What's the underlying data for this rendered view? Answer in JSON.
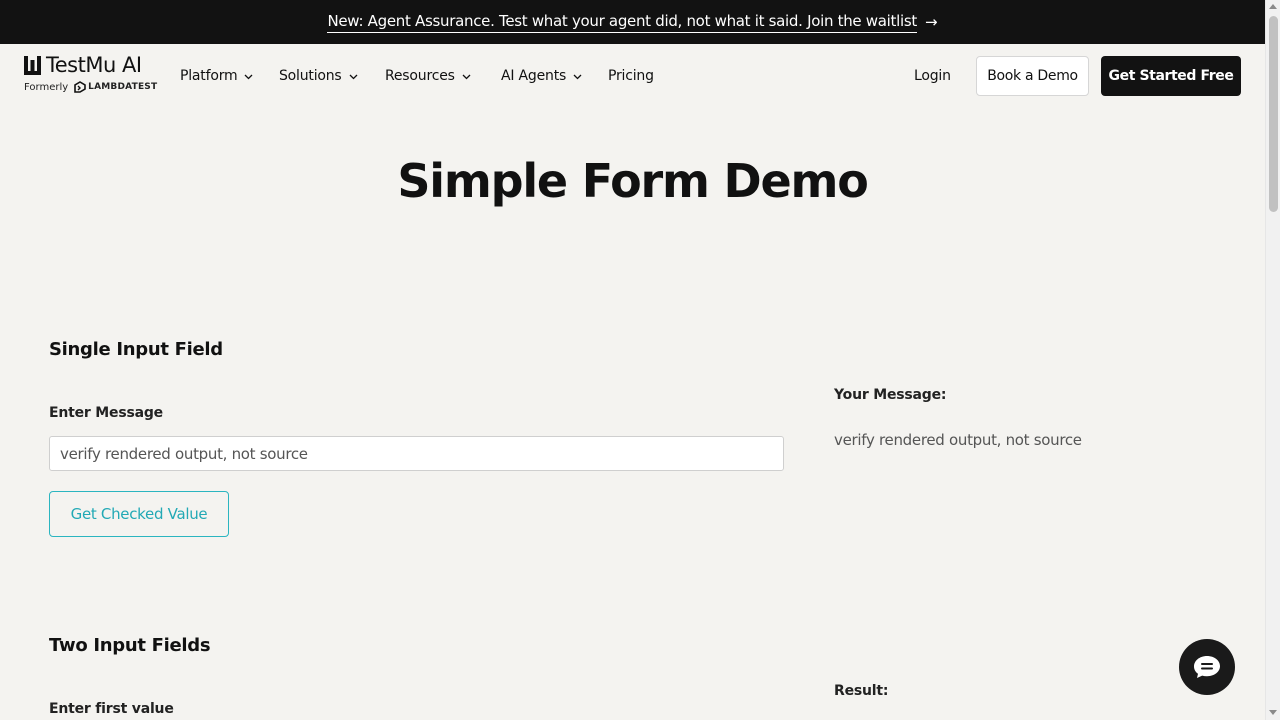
{
  "banner": {
    "text": "New: Agent Assurance. Test what your agent did, not what it said. Join the waitlist",
    "arrow_icon": "arrow-right-icon"
  },
  "header": {
    "logo_text": "TestMu AI",
    "logo_formerly": "Formerly",
    "logo_former_brand": "LAMBDATEST",
    "nav": [
      {
        "label": "Platform",
        "has_dropdown": true
      },
      {
        "label": "Solutions",
        "has_dropdown": true
      },
      {
        "label": "Resources",
        "has_dropdown": true
      },
      {
        "label": "AI Agents",
        "has_dropdown": true
      },
      {
        "label": "Pricing",
        "has_dropdown": false
      }
    ],
    "login_label": "Login",
    "demo_label": "Book a Demo",
    "start_label": "Get Started Free"
  },
  "page": {
    "title": "Simple Form Demo"
  },
  "single_input": {
    "section_title": "Single Input Field",
    "field_label": "Enter Message",
    "input_value": "verify rendered output, not source",
    "button_label": "Get Checked Value",
    "message_label": "Your Message:",
    "message_value": "verify rendered output, not source"
  },
  "two_inputs": {
    "section_title": "Two Input Fields",
    "first_label": "Enter first value",
    "result_label": "Result:"
  },
  "chat": {
    "icon": "chat-bubble-icon"
  },
  "colors": {
    "background": "#f4f3f0",
    "banner_bg": "#121212",
    "accent_teal": "#22a9b5",
    "primary_button_bg": "#121212"
  }
}
